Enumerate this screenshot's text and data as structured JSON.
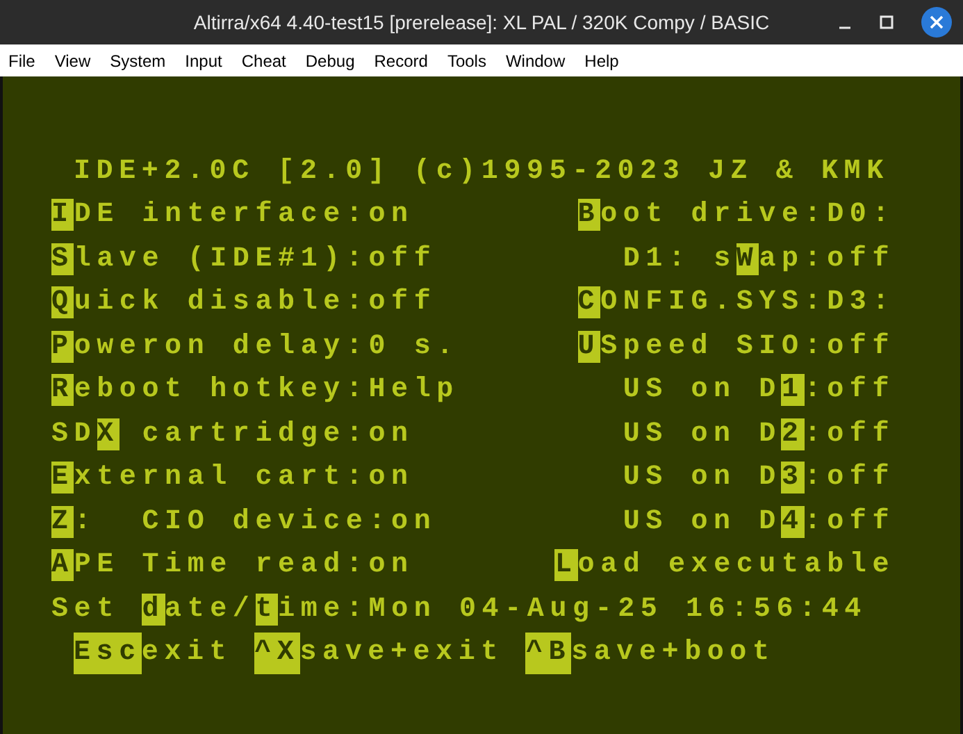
{
  "window": {
    "title": "Altirra/x64 4.40-test15 [prerelease]: XL PAL / 320K Compy / BASIC"
  },
  "menu": [
    "File",
    "View",
    "System",
    "Input",
    "Cheat",
    "Debug",
    "Record",
    "Tools",
    "Window",
    "Help"
  ],
  "screen": {
    "header": "IDE+2.0C [2.0] (c)1995-2023 JZ & KMK",
    "rows": [
      {
        "left": {
          "label": [
            {
              "text": "I",
              "inverse": true
            },
            {
              "text": "DE interface:",
              "inverse": false
            }
          ],
          "value": "on"
        },
        "right": {
          "label": [
            {
              "text": "B",
              "inverse": true
            },
            {
              "text": "oot drive:",
              "inverse": false
            }
          ],
          "value": "D0:"
        }
      },
      {
        "left": {
          "label": [
            {
              "text": "S",
              "inverse": true
            },
            {
              "text": "lave (IDE#1):",
              "inverse": false
            }
          ],
          "value": "off"
        },
        "right": {
          "label": [
            {
              "text": "D1: s",
              "inverse": false
            },
            {
              "text": "W",
              "inverse": true
            },
            {
              "text": "ap:",
              "inverse": false
            }
          ],
          "value": "off"
        }
      },
      {
        "left": {
          "label": [
            {
              "text": "Q",
              "inverse": true
            },
            {
              "text": "uick disable:",
              "inverse": false
            }
          ],
          "value": "off"
        },
        "right": {
          "label": [
            {
              "text": "C",
              "inverse": true
            },
            {
              "text": "ONFIG.SYS:",
              "inverse": false
            }
          ],
          "value": "D3:"
        }
      },
      {
        "left": {
          "label": [
            {
              "text": "P",
              "inverse": true
            },
            {
              "text": "oweron delay:",
              "inverse": false
            }
          ],
          "value": "0 s."
        },
        "right": {
          "label": [
            {
              "text": "U",
              "inverse": true
            },
            {
              "text": "Speed SIO:",
              "inverse": false
            }
          ],
          "value": "off"
        }
      },
      {
        "left": {
          "label": [
            {
              "text": "R",
              "inverse": true
            },
            {
              "text": "eboot hotkey:",
              "inverse": false
            }
          ],
          "value": "Help"
        },
        "right": {
          "label": [
            {
              "text": "US on D",
              "inverse": false
            },
            {
              "text": "1",
              "inverse": true
            },
            {
              "text": ":",
              "inverse": false
            }
          ],
          "value": "off"
        }
      },
      {
        "left": {
          "label": [
            {
              "text": "SD",
              "inverse": false
            },
            {
              "text": "X",
              "inverse": true
            },
            {
              "text": " cartridge:",
              "inverse": false
            }
          ],
          "value": "on"
        },
        "right": {
          "label": [
            {
              "text": "US on D",
              "inverse": false
            },
            {
              "text": "2",
              "inverse": true
            },
            {
              "text": ":",
              "inverse": false
            }
          ],
          "value": "off"
        }
      },
      {
        "left": {
          "label": [
            {
              "text": "E",
              "inverse": true
            },
            {
              "text": "xternal cart:",
              "inverse": false
            }
          ],
          "value": "on"
        },
        "right": {
          "label": [
            {
              "text": "US on D",
              "inverse": false
            },
            {
              "text": "3",
              "inverse": true
            },
            {
              "text": ":",
              "inverse": false
            }
          ],
          "value": "off"
        }
      },
      {
        "left": {
          "label": [
            {
              "text": "Z",
              "inverse": true
            },
            {
              "text": ":  CIO device:",
              "inverse": false
            }
          ],
          "value": "on"
        },
        "right": {
          "label": [
            {
              "text": "US on D",
              "inverse": false
            },
            {
              "text": "4",
              "inverse": true
            },
            {
              "text": ":",
              "inverse": false
            }
          ],
          "value": "off"
        }
      },
      {
        "left": {
          "label": [
            {
              "text": "A",
              "inverse": true
            },
            {
              "text": "PE Time read:",
              "inverse": false
            }
          ],
          "value": "on"
        },
        "right": {
          "label": [
            {
              "text": "L",
              "inverse": true
            },
            {
              "text": "oad executable",
              "inverse": false
            }
          ]
        }
      }
    ],
    "datetime": {
      "label": [
        {
          "text": "Set ",
          "inverse": false
        },
        {
          "text": "d",
          "inverse": true
        },
        {
          "text": "ate/",
          "inverse": false
        },
        {
          "text": "t",
          "inverse": true
        },
        {
          "text": "ime:",
          "inverse": false
        }
      ],
      "value": "Mon 04-Aug-25 16:56:44"
    },
    "footer": [
      {
        "key": "Esc",
        "action": "exit"
      },
      {
        "key": "^X",
        "action": "save+exit"
      },
      {
        "key": "^B",
        "action": "save+boot"
      }
    ]
  }
}
